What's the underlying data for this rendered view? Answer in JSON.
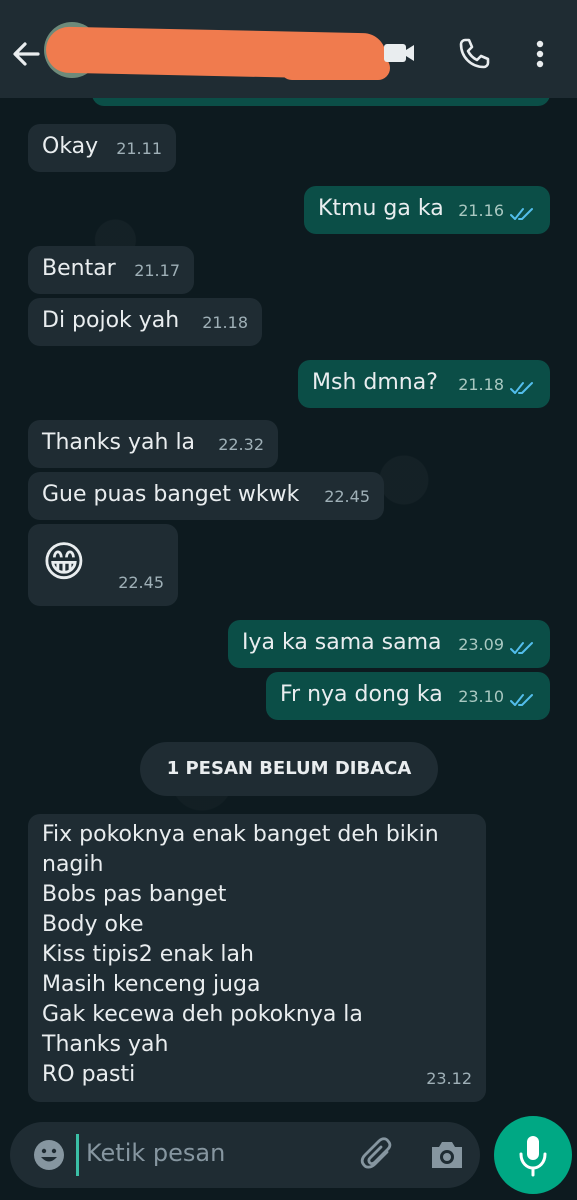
{
  "header": {
    "icons": {
      "back": "back-arrow-icon",
      "video": "video-call-icon",
      "phone": "phone-call-icon",
      "more": "more-vertical-icon"
    }
  },
  "messages": [
    {
      "dir": "in",
      "text": "Okay",
      "time": "21.11"
    },
    {
      "dir": "out",
      "text": "Ktmu ga ka",
      "time": "21.16"
    },
    {
      "dir": "in",
      "text": "Bentar",
      "time": "21.17"
    },
    {
      "dir": "in",
      "text": "Di pojok yah",
      "time": "21.18"
    },
    {
      "dir": "out",
      "text": "Msh dmna?",
      "time": "21.18"
    },
    {
      "dir": "in",
      "text": "Thanks yah la",
      "time": "22.32"
    },
    {
      "dir": "in",
      "text": "Gue puas banget wkwk",
      "time": "22.45"
    },
    {
      "dir": "in",
      "text": "😁",
      "time": "22.45"
    },
    {
      "dir": "out",
      "text": "Iya ka sama sama",
      "time": "23.09"
    },
    {
      "dir": "out",
      "text": "Fr nya dong ka",
      "time": "23.10"
    },
    {
      "dir": "in",
      "text": "Fix pokoknya enak banget deh bikin nagih\nBobs pas banget\nBody oke\nKiss tipis2 enak lah\nMasih kenceng juga\nGak kecewa deh pokoknya la\nThanks yah\nRO pasti",
      "time": "23.12"
    }
  ],
  "unread_label": "1 PESAN BELUM DIBACA",
  "composer": {
    "placeholder": "Ketik pesan",
    "icons": {
      "emoji": "emoji-icon",
      "attach": "attach-icon",
      "camera": "camera-icon",
      "mic": "mic-icon"
    }
  },
  "colors": {
    "header_bg": "#1f2c33",
    "incoming_bubble": "#1f2c33",
    "outgoing_bubble": "#0b4e47",
    "accent": "#00a884",
    "read_ticks": "#53bdeb"
  }
}
